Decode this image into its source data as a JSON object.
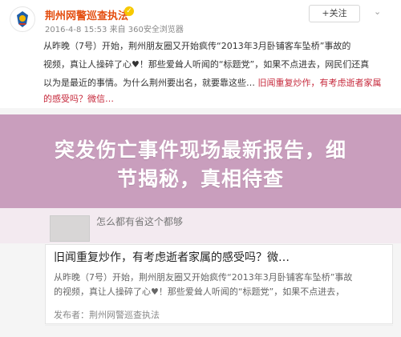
{
  "header": {
    "author": "荆州网警巡查执法",
    "verified_icon": "check-badge",
    "meta": "2016-4-8 15:53 来自 360安全浏览器",
    "follow_label": "+关注",
    "menu_icon": "chevron-down"
  },
  "post": {
    "line1": "从昨晚（7号）开始，荆州朋友圈又开始疯传“2013年3月卧铺客车坠桥”事故的",
    "line2": "视频，真让人操碎了心♥！那些爱耸人听闻的“标题党”，如果不点进去，网民们还真",
    "line3": "以为是最近的事情。为什么荆州要出名，就要靠这些…",
    "link": "旧闻重复炒作，有考虑逝者家属的感受吗？微信…"
  },
  "banner": {
    "line1": "突发伤亡事件现场最新报告，细",
    "line2": "节揭秘，真相待查"
  },
  "strip": {
    "text": "怎么都有省这个都够"
  },
  "card": {
    "title": "旧闻重复炒作，有考虑逝者家属的感受吗？微…",
    "text1": "从昨晚（7号）开始，荆州朋友圈又开始疯传“2013年3月卧铺客车坠桥”事故",
    "text2": "的视频，真让人操碎了心♥！那些爱耸人听闻的“标题党”，如果不点进去，",
    "footer": "发布者：荆州网警巡查执法"
  },
  "colors": {
    "accent": "#e44f11",
    "link": "#c6283b",
    "banner": "#c79bbb"
  }
}
